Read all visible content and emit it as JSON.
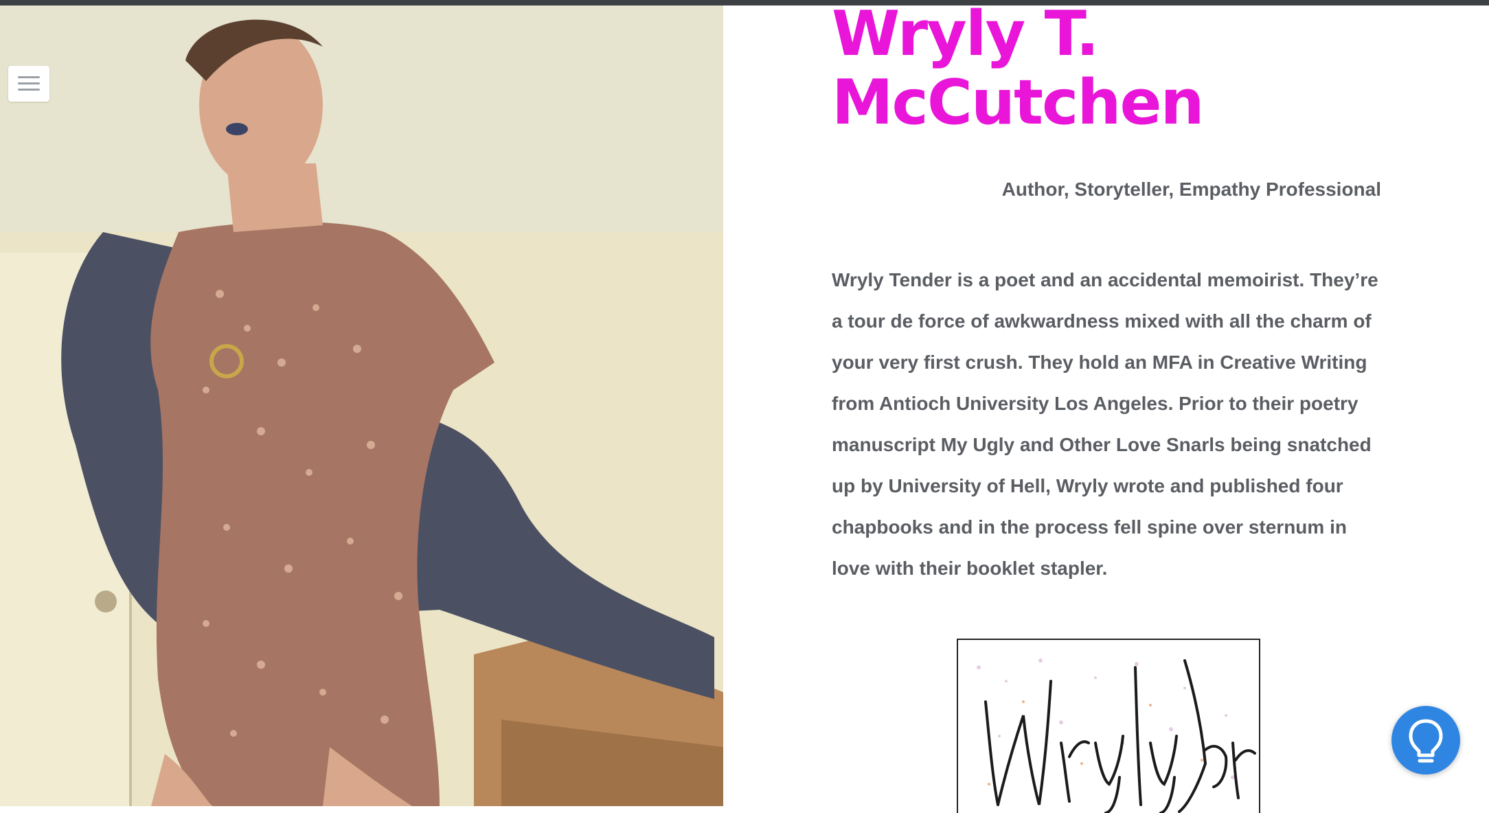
{
  "header": {
    "title": "Wryly T. McCutchen",
    "tagline": "Author, Storyteller, Empathy Professional"
  },
  "bio": {
    "text": "Wryly Tender is a poet and an accidental memoirist. They’re a tour de force of awkwardness mixed with all the charm of your very first crush. They hold an MFA in Creative Writing from Antioch University Los Angeles. Prior to their poetry manuscript My Ugly and Other Love Snarls being snatched up by University of Hell, Wryly wrote and published four chapbooks and in the process fell spine over sternum in love with their booklet stapler."
  },
  "signature": {
    "text": "Wryly Tender"
  },
  "icons": {
    "menu": "hamburger-menu-icon",
    "help": "lightbulb-icon"
  },
  "colors": {
    "title": "#e915d8",
    "text": "#5a5d62",
    "help_button": "#2f86e2",
    "top_bar": "#3d4144"
  }
}
